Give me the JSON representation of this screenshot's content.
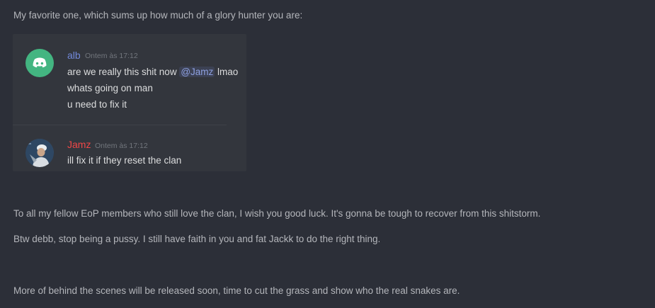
{
  "intro_text": "My favorite one, which sums up how much of a glory hunter you are:",
  "embed": {
    "messages": [
      {
        "username": "alb",
        "username_color": "#7289da",
        "timestamp": "Ontem às 17:12",
        "avatar": "discord-logo-icon",
        "lines": [
          {
            "before": "are we really this shit now ",
            "mention": "@Jamz",
            "after": " lmao"
          },
          {
            "text": "whats going on man"
          },
          {
            "text": "u need to fix it"
          }
        ]
      },
      {
        "username": "Jamz",
        "username_color": "#f04747",
        "timestamp": "Ontem às 17:12",
        "avatar": "user-photo-avatar",
        "lines": [
          {
            "text": "ill fix it if they reset the clan"
          }
        ]
      }
    ]
  },
  "paragraphs": [
    "To all my fellow EoP members who still love the clan, I wish you good luck. It's gonna be tough to recover from this shitstorm.",
    "Btw debb, stop being a pussy. I still have faith in you and fat Jackk to do the right thing.",
    "More of behind the scenes will be released soon, time to cut the grass and show who the real snakes are."
  ]
}
